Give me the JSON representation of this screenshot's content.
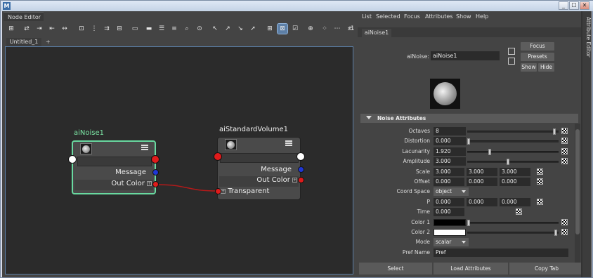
{
  "window": {
    "app_icon": "M",
    "min": "_",
    "max": "☐",
    "close": "✕"
  },
  "node_editor": {
    "panel_tab": "Node Editor",
    "doc_tab": "Untitled_1",
    "doc_add": "+",
    "toolbar_icons": [
      {
        "name": "graph-icon",
        "glyph": "⊞"
      },
      {
        "name": "swap-icon",
        "glyph": "⇄"
      },
      {
        "name": "input-connections-icon",
        "glyph": "⇥"
      },
      {
        "name": "output-connections-icon",
        "glyph": "⇤"
      },
      {
        "name": "in-out-connections-icon",
        "glyph": "↔"
      },
      {
        "name": "frame-all-icon",
        "glyph": "⊡"
      },
      {
        "name": "layout-icon",
        "glyph": "⋮"
      },
      {
        "name": "arrange-icon",
        "glyph": "⇉"
      },
      {
        "name": "align-icon",
        "glyph": "⊟"
      },
      {
        "name": "simple-view-icon",
        "glyph": "▭"
      },
      {
        "name": "connected-view-icon",
        "glyph": "▬"
      },
      {
        "name": "full-view-icon",
        "glyph": "☰"
      },
      {
        "name": "custom-view-icon",
        "glyph": "≡"
      },
      {
        "name": "search-icon",
        "glyph": "⌕"
      },
      {
        "name": "frame-selection-icon",
        "glyph": "⊙"
      },
      {
        "name": "select-arrow-icon",
        "glyph": "↖"
      },
      {
        "name": "select-upstream-icon",
        "glyph": "↗"
      },
      {
        "name": "select-downstream-icon",
        "glyph": "↘"
      },
      {
        "name": "select-all-arrow-icon",
        "glyph": "➚"
      },
      {
        "name": "snap-grid-icon",
        "glyph": "⊞"
      },
      {
        "name": "grid-toggle-icon",
        "glyph": "⊠"
      },
      {
        "name": "attribute-view-icon",
        "glyph": "☑"
      },
      {
        "name": "pin-icon",
        "glyph": "⊕"
      },
      {
        "name": "pick-walk-icon",
        "glyph": "⁘"
      },
      {
        "name": "more-icon",
        "glyph": "⋯"
      },
      {
        "name": "zoom-icon",
        "glyph": "±"
      },
      {
        "name": "overflow-icon",
        "glyph": "-1"
      }
    ],
    "nodes": {
      "noise": {
        "title": "aiNoise1",
        "attrs": [
          "Message",
          "Out Color"
        ]
      },
      "volume": {
        "title": "aiStandardVolume1",
        "attrs": [
          "Message",
          "Out Color",
          "Transparent"
        ]
      }
    },
    "colors": {
      "selected_border": "#69d9a0",
      "title_selected": "#7de8a6",
      "connection": "#b21a1a"
    }
  },
  "attribute_editor": {
    "menu": [
      "List",
      "Selected",
      "Focus",
      "Attributes",
      "Show",
      "Help"
    ],
    "tab": "aiNoise1",
    "node_label": "aiNoise:",
    "node_value": "aiNoise1",
    "buttons": {
      "focus": "Focus",
      "presets": "Presets",
      "show": "Show",
      "hide": "Hide"
    },
    "section": "Noise Attributes",
    "attributes": [
      {
        "label": "Octaves",
        "type": "slider",
        "value": "8",
        "slider": 0.98
      },
      {
        "label": "Distortion",
        "type": "slider",
        "value": "0.000",
        "slider": 0.0
      },
      {
        "label": "Lacunarity",
        "type": "slider",
        "value": "1.920",
        "slider": 0.24
      },
      {
        "label": "Amplitude",
        "type": "slider",
        "value": "3.000",
        "slider": 0.45
      },
      {
        "label": "Scale",
        "type": "triple",
        "values": [
          "3.000",
          "3.000",
          "3.000"
        ]
      },
      {
        "label": "Offset",
        "type": "triple",
        "values": [
          "0.000",
          "0.000",
          "0.000"
        ]
      },
      {
        "label": "Coord Space",
        "type": "dropdown",
        "value": "object"
      },
      {
        "label": "P",
        "type": "triple",
        "values": [
          "0.000",
          "0.000",
          "0.000"
        ]
      },
      {
        "label": "Time",
        "type": "single",
        "value": "0.000"
      },
      {
        "label": "Color 1",
        "type": "color",
        "color": "#000000",
        "slider": 0.0
      },
      {
        "label": "Color 2",
        "type": "color",
        "color": "#ffffff",
        "slider": 1.0
      },
      {
        "label": "Mode",
        "type": "dropdown",
        "value": "scalar"
      },
      {
        "label": "Pref Name",
        "type": "text",
        "value": "Pref"
      }
    ],
    "footer": [
      "Select",
      "Load Attributes",
      "Copy Tab"
    ],
    "side_tab": "Attribute Editor"
  }
}
